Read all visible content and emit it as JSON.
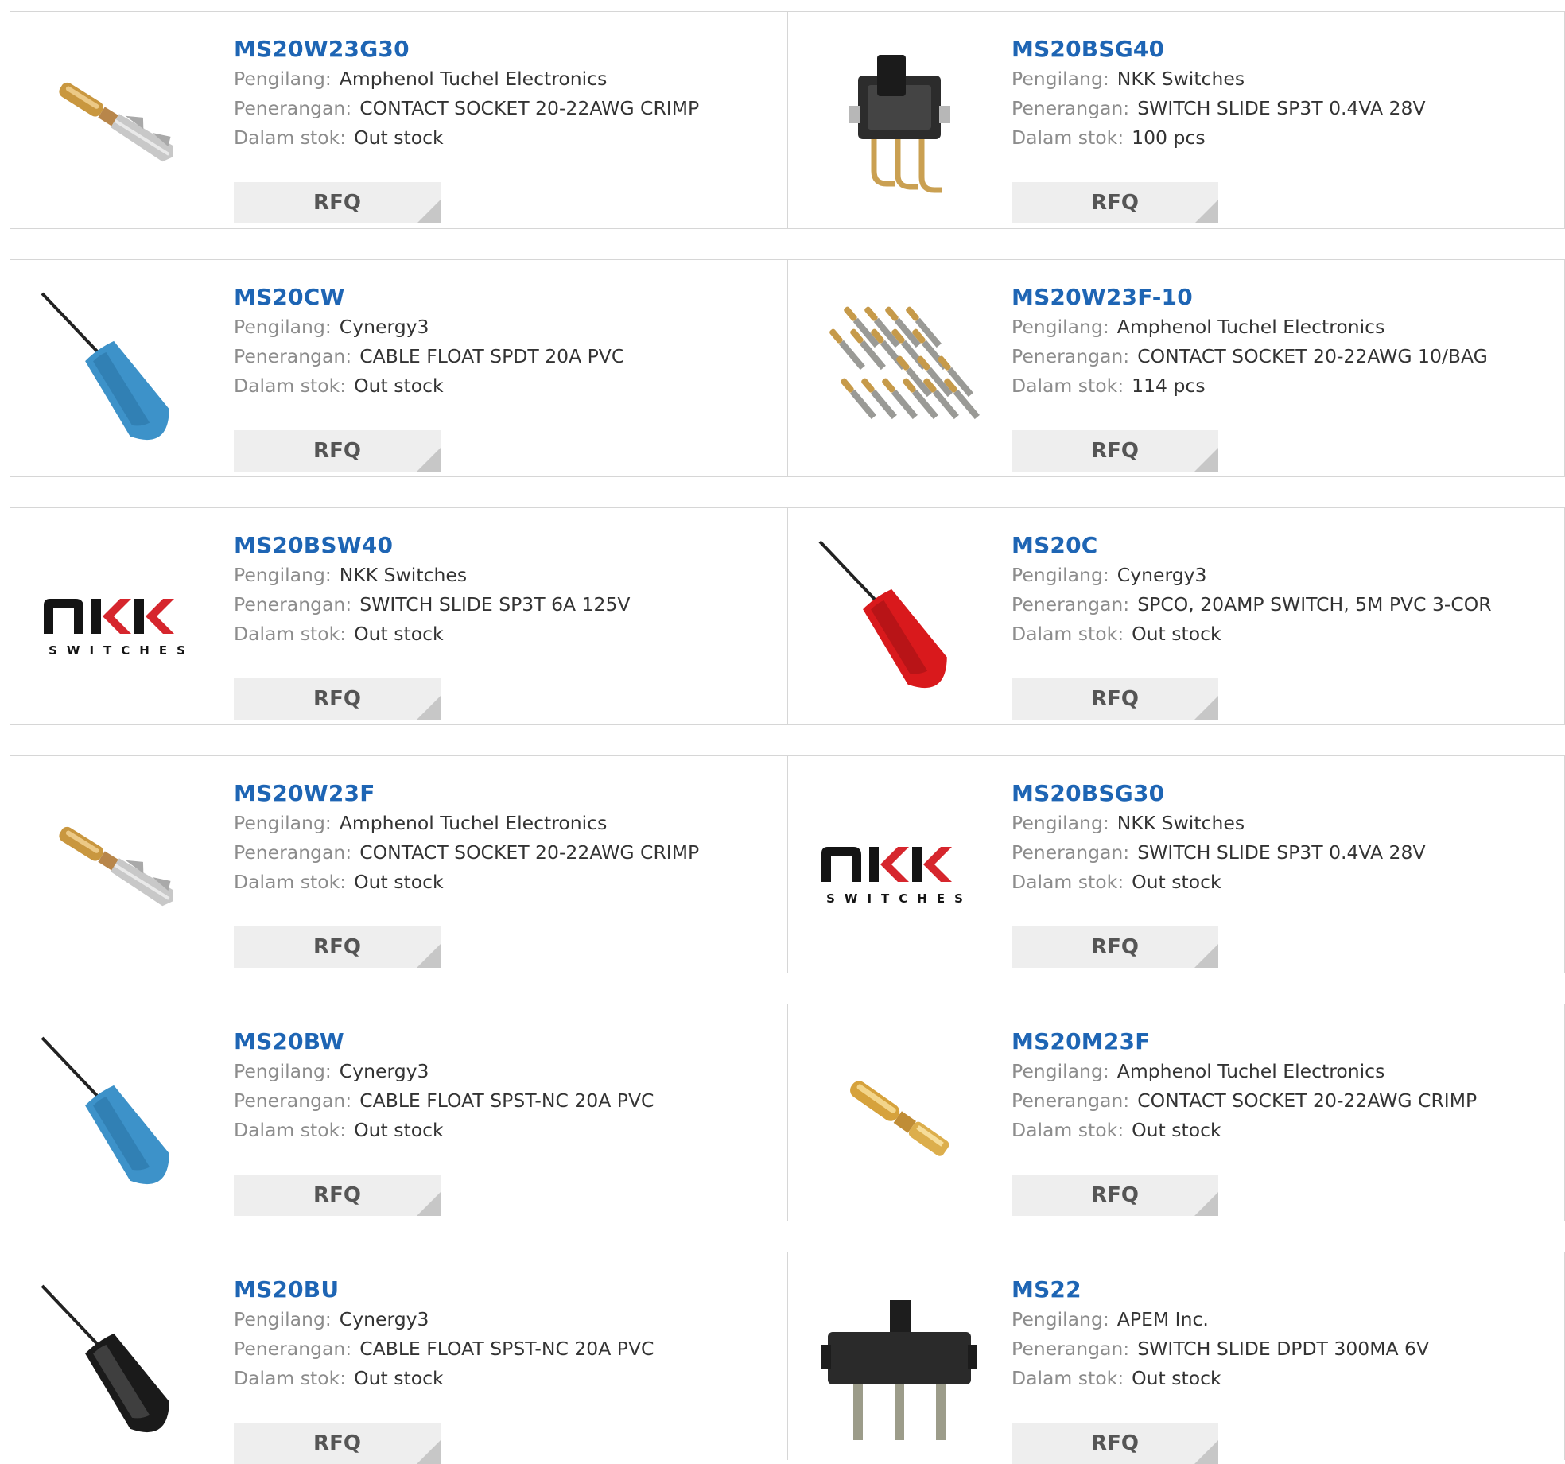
{
  "labels": {
    "manufacturer": "Pengilang:",
    "description": "Penerangan:",
    "stock": "Dalam stok:",
    "rfq": "RFQ"
  },
  "colors": {
    "part_link": "#1e65b4",
    "label_gray": "#8c8c8c",
    "button_bg": "#eeeeee",
    "border": "#d6d6d6"
  },
  "products": [
    {
      "part": "MS20W23G30",
      "manufacturer": "Amphenol Tuchel Electronics",
      "description": "CONTACT SOCKET 20-22AWG CRIMP",
      "stock": "Out stock",
      "image": "crimp-contact-image"
    },
    {
      "part": "MS20BSG40",
      "manufacturer": "NKK Switches",
      "description": "SWITCH SLIDE SP3T 0.4VA 28V",
      "stock": "100 pcs",
      "image": "slide-switch-image"
    },
    {
      "part": "MS20CW",
      "manufacturer": "Cynergy3",
      "description": "CABLE FLOAT SPDT 20A PVC",
      "stock": "Out stock",
      "image": "blue-float-switch-image"
    },
    {
      "part": "MS20W23F-10",
      "manufacturer": "Amphenol Tuchel Electronics",
      "description": "CONTACT SOCKET 20-22AWG 10/BAG",
      "stock": "114 pcs",
      "image": "contact-bag-image"
    },
    {
      "part": "MS20BSW40",
      "manufacturer": "NKK Switches",
      "description": "SWITCH SLIDE SP3T 6A 125V",
      "stock": "Out stock",
      "image": "nkk-logo-image"
    },
    {
      "part": "MS20C",
      "manufacturer": "Cynergy3",
      "description": "SPCO, 20AMP SWITCH, 5M PVC 3-COR",
      "stock": "Out stock",
      "image": "red-float-switch-image"
    },
    {
      "part": "MS20W23F",
      "manufacturer": "Amphenol Tuchel Electronics",
      "description": "CONTACT SOCKET 20-22AWG CRIMP",
      "stock": "Out stock",
      "image": "crimp-contact-image"
    },
    {
      "part": "MS20BSG30",
      "manufacturer": "NKK Switches",
      "description": "SWITCH SLIDE SP3T 0.4VA 28V",
      "stock": "Out stock",
      "image": "nkk-logo-image"
    },
    {
      "part": "MS20BW",
      "manufacturer": "Cynergy3",
      "description": "CABLE FLOAT SPST-NC 20A PVC",
      "stock": "Out stock",
      "image": "blue-float-switch-image"
    },
    {
      "part": "MS20M23F",
      "manufacturer": "Amphenol Tuchel Electronics",
      "description": "CONTACT SOCKET 20-22AWG CRIMP",
      "stock": "Out stock",
      "image": "gold-contact-image"
    },
    {
      "part": "MS20BU",
      "manufacturer": "Cynergy3",
      "description": "CABLE FLOAT SPST-NC 20A PVC",
      "stock": "Out stock",
      "image": "black-float-switch-image"
    },
    {
      "part": "MS22",
      "manufacturer": "APEM Inc.",
      "description": "SWITCH SLIDE DPDT 300MA 6V",
      "stock": "Out stock",
      "image": "black-slide-switch-image"
    }
  ],
  "nkk_logo": {
    "wordmark": "NKK",
    "tagline": "SWITCHES"
  }
}
